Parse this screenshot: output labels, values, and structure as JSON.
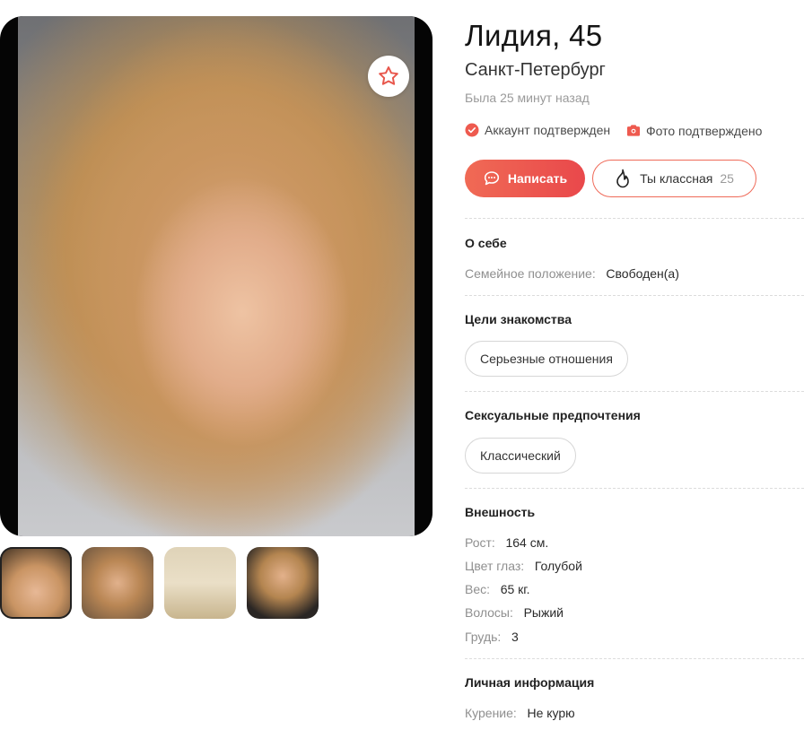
{
  "profile": {
    "name_age": "Лидия, 45",
    "city": "Санкт-Петербург",
    "last_seen": "Была 25 минут назад",
    "badges": [
      {
        "icon": "check-circle-icon",
        "label": "Аккаунт подтвержден"
      },
      {
        "icon": "camera-icon",
        "label": "Фото подтверждено"
      }
    ]
  },
  "actions": {
    "write_label": "Написать",
    "like_label": "Ты классная",
    "like_count": "25"
  },
  "about": {
    "title": "О себе",
    "rows": [
      {
        "label": "Семейное положение:",
        "value": "Свободен(а)"
      }
    ]
  },
  "goals": {
    "title": "Цели знакомства",
    "chips": [
      "Серьезные отношения"
    ]
  },
  "sexual": {
    "title": "Сексуальные предпочтения",
    "chips": [
      "Классический"
    ]
  },
  "appearance": {
    "title": "Внешность",
    "rows": [
      {
        "label": "Рост:",
        "value": "164 см."
      },
      {
        "label": "Цвет глаз:",
        "value": "Голубой"
      },
      {
        "label": "Вес:",
        "value": "65 кг."
      },
      {
        "label": "Волосы:",
        "value": "Рыжий"
      },
      {
        "label": "Грудь:",
        "value": "3"
      }
    ]
  },
  "personal": {
    "title": "Личная информация",
    "rows": [
      {
        "label": "Курение:",
        "value": "Не курю"
      }
    ]
  },
  "colors": {
    "accent": "#ee5a4f",
    "accent_gradient_end": "#e9484b",
    "muted_text": "#9a9a9a"
  }
}
